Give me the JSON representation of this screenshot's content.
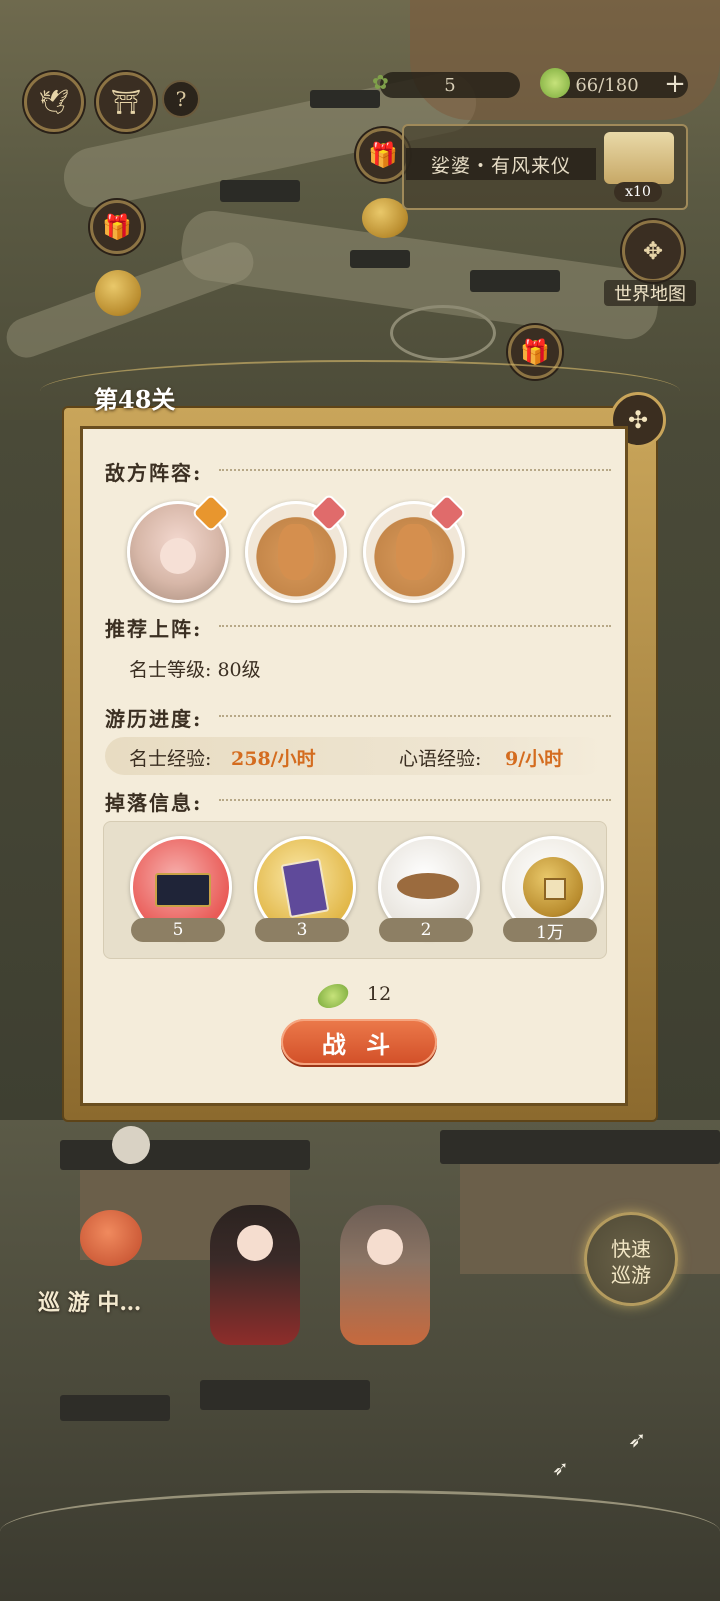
{
  "hud": {
    "stamina_value": "5",
    "energy_value": "66/180",
    "plus_label": "+",
    "help_label": "?"
  },
  "event_banner": {
    "title": "娑婆・有风来仪",
    "multiplier": "x10"
  },
  "world_map_label": "世界地图",
  "level_title": "第48关",
  "sections": {
    "enemy": "敌方阵容:",
    "recommend": "推荐上阵:",
    "progress": "游历进度:",
    "drops": "掉落信息:"
  },
  "recommend": {
    "level_label": "名士等级:",
    "level_value": "80级"
  },
  "progress": {
    "exp_label": "名士经验:",
    "exp_value": "258/小时",
    "heart_label": "心语经验:",
    "heart_value": "9/小时"
  },
  "enemies": [
    {
      "name": "girl-avatar",
      "badge_color": "#e8962e"
    },
    {
      "name": "deer-avatar",
      "badge_color": "#e06b6b"
    },
    {
      "name": "deer-avatar",
      "badge_color": "#e06b6b"
    }
  ],
  "drops": [
    {
      "icon": "chest-icon",
      "count": "5",
      "bg": "#e95b57"
    },
    {
      "icon": "book-icon",
      "count": "3",
      "bg": "#e2b84a"
    },
    {
      "icon": "plate-icon",
      "count": "2",
      "bg": "#e7e3dc"
    },
    {
      "icon": "coin-icon",
      "count": "1万",
      "bg": "#ece8df"
    }
  ],
  "cost": "12",
  "battle_label": "战 斗",
  "quick_tour_label_1": "快速",
  "quick_tour_label_2": "巡游",
  "touring_label": "巡 游 中…",
  "colors": {
    "accent": "#d46c1f",
    "button": "#d9542c",
    "frame": "#8c6a2e"
  }
}
